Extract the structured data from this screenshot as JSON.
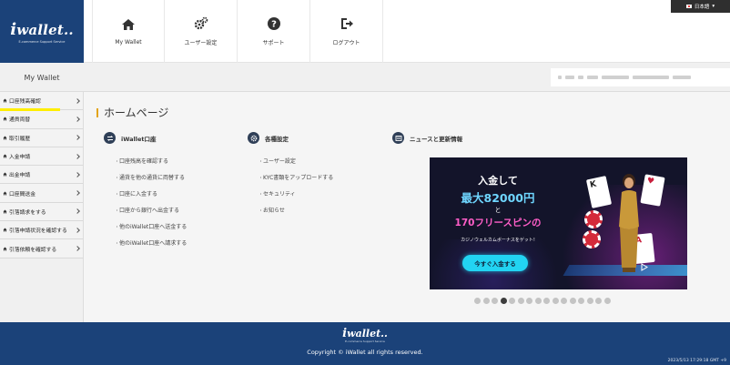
{
  "brand": {
    "name": "wallet..",
    "tagline": "E-commerce Support Service"
  },
  "header": {
    "language": "日本語",
    "nav": [
      {
        "label": "My Wallet",
        "icon": "home-icon"
      },
      {
        "label": "ユーザー設定",
        "icon": "gears-icon"
      },
      {
        "label": "サポート",
        "icon": "question-circle-icon"
      },
      {
        "label": "ログアウト",
        "icon": "sign-out-icon"
      }
    ]
  },
  "sidebar": {
    "title": "My Wallet",
    "items": [
      {
        "label": "口座残高確認"
      },
      {
        "label": "通貨両替"
      },
      {
        "label": "取引履歴"
      },
      {
        "label": "入金申請"
      },
      {
        "label": "出金申請"
      },
      {
        "label": "口座間送金"
      },
      {
        "label": "引落請求をする"
      },
      {
        "label": "引落申請状況を確認する"
      },
      {
        "label": "引落依頼を確認する"
      }
    ]
  },
  "main": {
    "title": "ホームページ",
    "sections": [
      {
        "title": "iWallet口座",
        "icon": "exchange-icon",
        "links": [
          "口座残高を確認する",
          "通貨を他の通貨に両替する",
          "口座に入金する",
          "口座から銀行へ出金する",
          "他のiWallet口座へ送金する",
          "他のiWallet口座へ請求する"
        ]
      },
      {
        "title": "各種設定",
        "icon": "gear-icon",
        "links": [
          "ユーザー設定",
          "KYC書類をアップロードする",
          "セキュリティ",
          "お知らせ"
        ]
      },
      {
        "title": "ニュースと更新情報",
        "icon": "news-icon",
        "links": []
      }
    ],
    "banner": {
      "line1": "入金して",
      "line2": "最大82000円",
      "line3": "と",
      "line4": "170フリースピンの",
      "line5": "カジノウェルカムボーナスをゲット!",
      "cta": "今すぐ入金する"
    },
    "carousel": {
      "count": 16,
      "active_index": 3
    }
  },
  "footer": {
    "brand": "wallet..",
    "tagline": "E-commerce Support Service",
    "copyright": "Copyright © iWallet all rights reserved.",
    "timestamp": "2023/5/13 17:29:18 GMT +9"
  },
  "colors": {
    "primary": "#1b4279",
    "accent_cyan": "#22d4f2",
    "accent_pink": "#ff5ec8",
    "highlight": "#ffee00"
  }
}
